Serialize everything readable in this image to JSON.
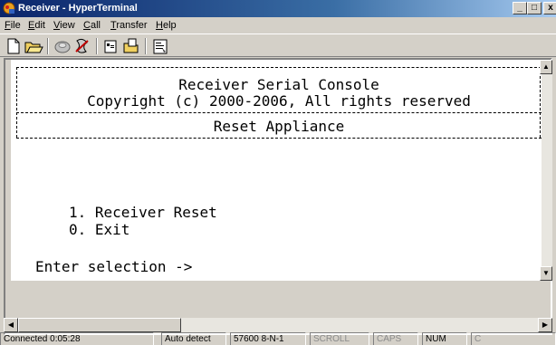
{
  "window": {
    "title": "Receiver - HyperTerminal",
    "controls": {
      "minimize": "_",
      "maximize": "□",
      "close": "x"
    }
  },
  "menubar": {
    "items": [
      {
        "label": "File",
        "accel": "F",
        "rest": "ile"
      },
      {
        "label": "Edit",
        "accel": "E",
        "rest": "dit"
      },
      {
        "label": "View",
        "accel": "V",
        "rest": "iew"
      },
      {
        "label": "Call",
        "accel": "C",
        "rest": "all"
      },
      {
        "label": "Transfer",
        "accel": "T",
        "rest": "ransfer"
      },
      {
        "label": "Help",
        "accel": "H",
        "rest": "elp"
      }
    ]
  },
  "toolbar": {
    "icons": [
      "new-icon",
      "open-icon",
      "connect-icon",
      "disconnect-icon",
      "send-icon",
      "receive-icon",
      "properties-icon"
    ]
  },
  "terminal": {
    "header_line1": "Receiver Serial Console",
    "header_line2": "Copyright (c) 2000-2006, All rights reserved",
    "section_title": "Reset Appliance",
    "options": [
      "1. Receiver Reset",
      "0. Exit"
    ],
    "prompt": "Enter selection ->"
  },
  "statusbar": {
    "connected": "Connected 0:05:28",
    "detect": "Auto detect",
    "port_settings": "57600 8-N-1",
    "scroll": "SCROLL",
    "caps": "CAPS",
    "num": "NUM",
    "capture": "C"
  },
  "colors": {
    "title_bar": "#0a246a",
    "window_face": "#d4d0c8",
    "terminal_bg": "#ffffff",
    "terminal_text": "#000000"
  }
}
